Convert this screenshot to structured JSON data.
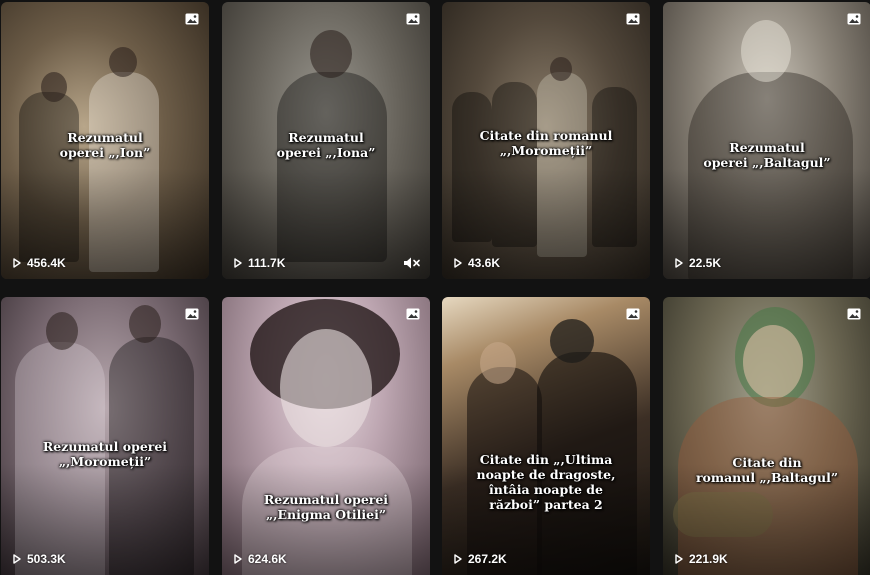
{
  "cards": [
    {
      "caption_lines": [
        "Rezumatul",
        "operei „,Ion”"
      ],
      "views": "456.4K",
      "type_icon": "image-icon",
      "muted": false
    },
    {
      "caption_lines": [
        "Rezumatul",
        "operei „,Iona”"
      ],
      "views": "111.7K",
      "type_icon": "image-icon",
      "muted": true
    },
    {
      "caption_lines": [
        "Citate din romanul",
        "„,Moromeții”"
      ],
      "views": "43.6K",
      "type_icon": "image-icon",
      "muted": false
    },
    {
      "caption_lines": [
        "Rezumatul",
        "operei „,Baltagul”"
      ],
      "views": "22.5K",
      "type_icon": "image-icon",
      "muted": false
    },
    {
      "caption_lines": [
        "Rezumatul operei",
        "„,Moromeții”"
      ],
      "views": "503.3K",
      "type_icon": "image-icon",
      "muted": false
    },
    {
      "caption_lines": [
        "Rezumatul operei",
        "„,Enigma Otiliei”"
      ],
      "views": "624.6K",
      "type_icon": "image-icon",
      "muted": false
    },
    {
      "caption_lines": [
        "Citate din „,Ultima",
        "noapte de dragoste,",
        "întâia noapte de",
        "război” partea 2"
      ],
      "views": "267.2K",
      "type_icon": "image-icon",
      "muted": false
    },
    {
      "caption_lines": [
        "Citate din",
        "romanul „,Baltagul”"
      ],
      "views": "221.9K",
      "type_icon": "image-icon",
      "muted": false
    }
  ],
  "colors": {
    "background": "#121212",
    "text": "#ffffff"
  },
  "icons": {
    "views": "play-icon",
    "muted": "speaker-muted-icon",
    "post_type": "image-icon"
  }
}
